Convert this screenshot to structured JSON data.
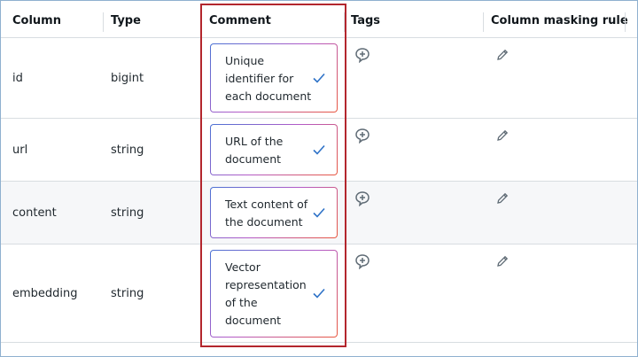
{
  "columns": {
    "column": "Column",
    "type": "Type",
    "comment": "Comment",
    "tags": "Tags",
    "masking": "Column masking rule"
  },
  "rows": [
    {
      "name": "id",
      "type": "bigint",
      "comment": "Unique identifier for each document"
    },
    {
      "name": "url",
      "type": "string",
      "comment": "URL of the document"
    },
    {
      "name": "content",
      "type": "string",
      "comment": "Text content of the document"
    },
    {
      "name": "embedding",
      "type": "string",
      "comment": "Vector representation of the document"
    }
  ],
  "icons": {
    "add_tag": "add-tag-icon",
    "edit_masking": "pencil-icon",
    "confirm": "checkmark-icon"
  },
  "colors": {
    "highlight": "#b3262d",
    "check": "#2e72c7",
    "icon": "#5f6b75"
  }
}
